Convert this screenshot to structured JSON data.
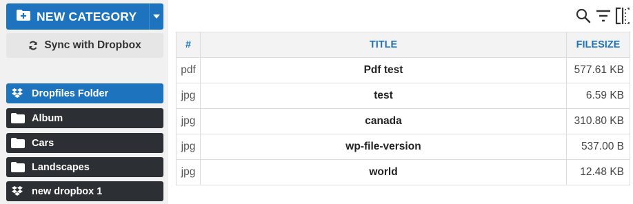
{
  "sidebar": {
    "new_category_label": "NEW CATEGORY",
    "sync_label": "Sync with Dropbox",
    "folders": [
      {
        "name": "Dropfiles Folder",
        "icon": "dropbox-icon",
        "active": true
      },
      {
        "name": "Album",
        "icon": "folder-icon",
        "active": false
      },
      {
        "name": "Cars",
        "icon": "folder-icon",
        "active": false
      },
      {
        "name": "Landscapes",
        "icon": "folder-icon",
        "active": false
      },
      {
        "name": "new dropbox 1",
        "icon": "dropbox-icon",
        "active": false
      }
    ]
  },
  "toolbar": {
    "icons": [
      "search-icon",
      "filter-icon",
      "columns-icon"
    ]
  },
  "table": {
    "headers": {
      "ext": "#",
      "title": "TITLE",
      "size": "FILESIZE"
    },
    "rows": [
      {
        "ext": "pdf",
        "title": "Pdf test",
        "size": "577.61 KB"
      },
      {
        "ext": "jpg",
        "title": "test",
        "size": "6.59 KB"
      },
      {
        "ext": "jpg",
        "title": "canada",
        "size": "310.80 KB"
      },
      {
        "ext": "jpg",
        "title": "wp-file-version",
        "size": "537.00 B"
      },
      {
        "ext": "jpg",
        "title": "world",
        "size": "12.48 KB"
      }
    ]
  },
  "colors": {
    "accent": "#1e73be",
    "dark_folder": "#2c2f33",
    "sidebar_bg": "#f1f1f1"
  }
}
